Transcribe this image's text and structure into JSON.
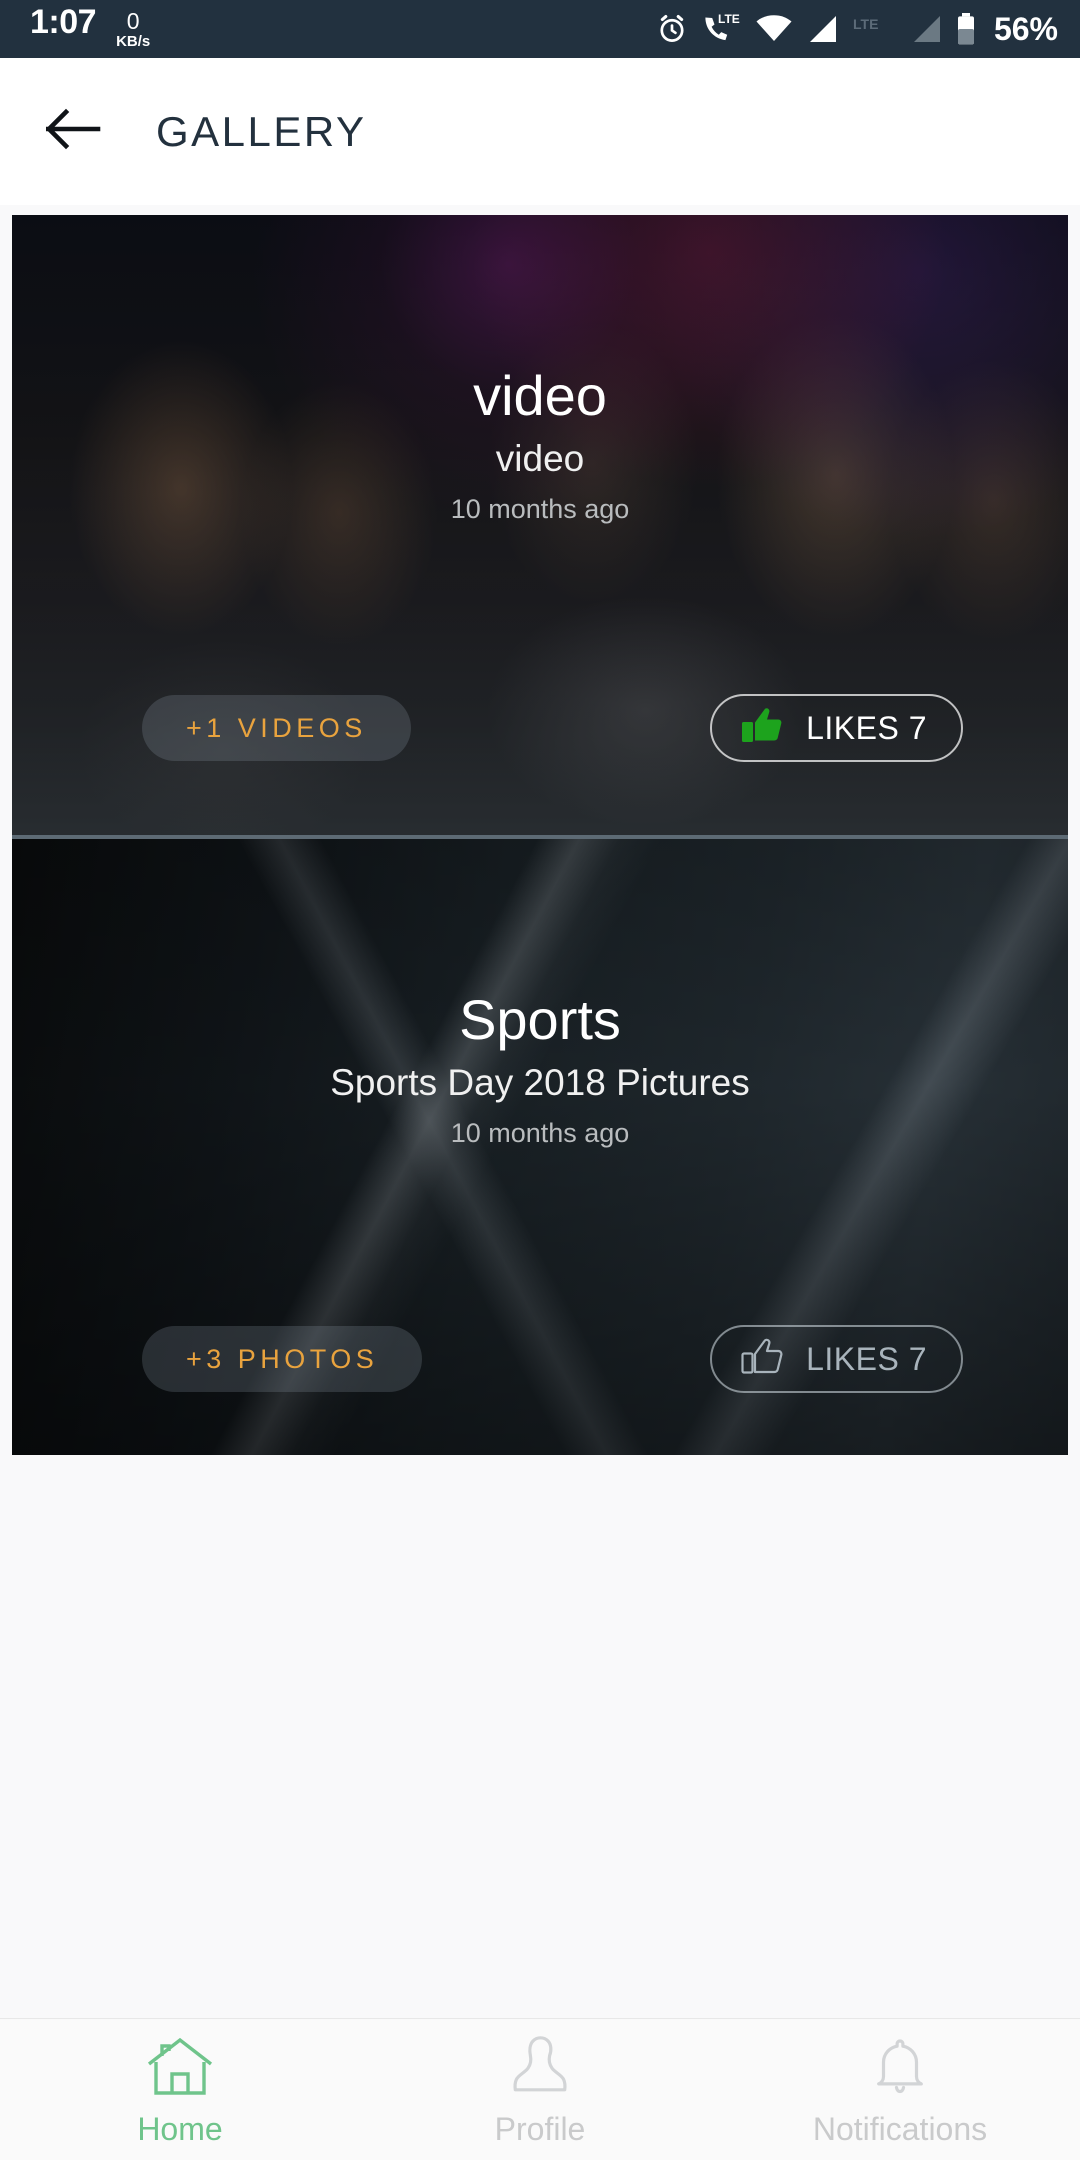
{
  "status_bar": {
    "time": "1:07",
    "net_rate": "0",
    "net_unit": "KB/s",
    "battery_percent": "56%",
    "icons": [
      "alarm-clock-icon",
      "lte-call-icon",
      "wifi-icon",
      "signal-bars-icon",
      "lte-label-icon",
      "signal-bars-secondary-icon",
      "battery-icon"
    ],
    "background_color": "#22313F"
  },
  "app_bar": {
    "back_icon": "arrow-left-icon",
    "title": "GALLERY",
    "title_color": "#23313E",
    "background_color": "#FFFFFF"
  },
  "theme": {
    "page_background": "#F9F9FA",
    "accent_orange": "#E9A33E",
    "accent_green": "#6FC48B",
    "like_active_green": "#1DA31D",
    "inactive_grey": "#A9B4BC"
  },
  "gallery": {
    "cards": [
      {
        "title": "video",
        "subtitle": "video",
        "date": "10 months ago",
        "count_label": "+1  VIDEOS",
        "likes_label": "LIKES 7",
        "likes_count": 7,
        "liked": true,
        "thumb_icon": "thumbs-up-filled-icon"
      },
      {
        "title": "Sports",
        "subtitle": "Sports Day 2018 Pictures",
        "date": "10 months ago",
        "count_label": "+3  PHOTOS",
        "likes_label": "LIKES 7",
        "likes_count": 7,
        "liked": false,
        "thumb_icon": "thumbs-up-outline-icon"
      }
    ]
  },
  "bottom_nav": {
    "items": [
      {
        "label": "Home",
        "icon": "home-icon",
        "active": true
      },
      {
        "label": "Profile",
        "icon": "person-icon",
        "active": false
      },
      {
        "label": "Notifications",
        "icon": "bell-icon",
        "active": false
      }
    ]
  }
}
